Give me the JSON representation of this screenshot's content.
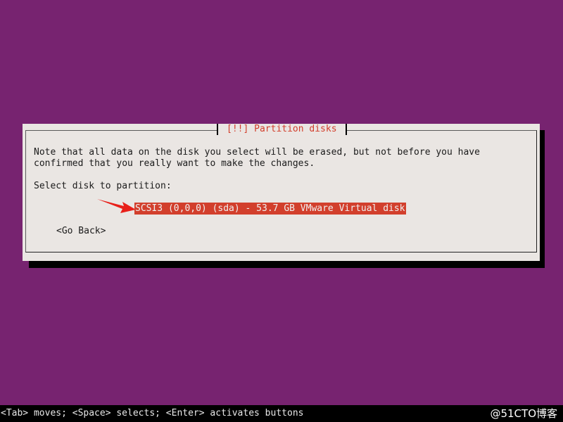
{
  "dialog": {
    "title": "[!!] Partition disks",
    "message_line1": "Note that all data on the disk you select will be erased, but not before you have",
    "message_line2": "confirmed that you really want to make the changes.",
    "prompt": "Select disk to partition:",
    "disks": [
      {
        "label": "SCSI3 (0,0,0) (sda) - 53.7 GB VMware Virtual disk",
        "selected": true
      }
    ],
    "go_back_label": "<Go Back>"
  },
  "statusbar": {
    "help_text": "<Tab> moves; <Space> selects; <Enter> activates buttons"
  },
  "watermark": {
    "text": "@51CTO博客"
  },
  "colors": {
    "background": "#772370",
    "dialog_bg": "#eae6e3",
    "accent": "#d23f2c",
    "text": "#1b1b1b",
    "shadow": "#000000"
  },
  "icons": {
    "annotation_arrow": "arrow-right-icon"
  }
}
